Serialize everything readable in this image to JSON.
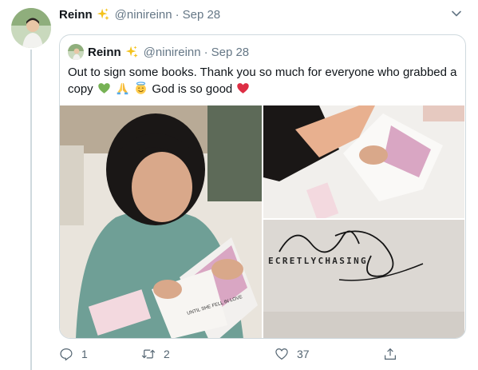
{
  "tweet": {
    "author_name": "Reinn",
    "author_emoji": "sparkles-icon",
    "handle": "@ninireinn",
    "separator": "·",
    "date": "Sep 28"
  },
  "quoted": {
    "author_name": "Reinn",
    "handle": "@ninireinn",
    "separator": "·",
    "date": "Sep 28",
    "text_part1": "Out to sign some books. Thank you so much for everyone who grabbed a copy",
    "text_part2": "God is so good",
    "emojis": [
      "green-heart-icon",
      "praying-hands-icon",
      "smiling-halo-icon",
      "red-heart-icon"
    ],
    "book_text": "UNTIL SHE FELL IN LOVE",
    "signature_text": "ECRETLYCHASING"
  },
  "actions": {
    "reply_count": "1",
    "retweet_count": "2",
    "like_count": "37"
  },
  "colors": {
    "text_primary": "#0f1419",
    "text_secondary": "#657786",
    "border": "#cfd9de",
    "action_gray": "#536471",
    "heart_red": "#e0245e"
  }
}
